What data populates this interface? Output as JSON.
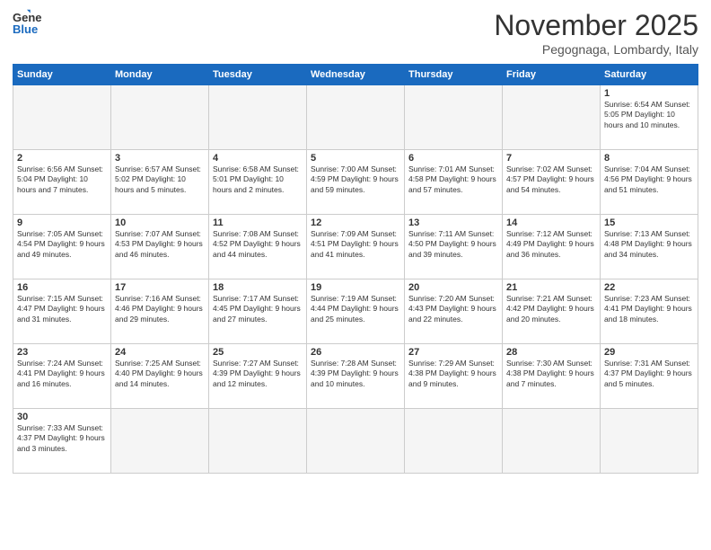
{
  "header": {
    "logo_general": "General",
    "logo_blue": "Blue",
    "month_title": "November 2025",
    "subtitle": "Pegognaga, Lombardy, Italy"
  },
  "days_of_week": [
    "Sunday",
    "Monday",
    "Tuesday",
    "Wednesday",
    "Thursday",
    "Friday",
    "Saturday"
  ],
  "weeks": [
    [
      {
        "day": "",
        "info": ""
      },
      {
        "day": "",
        "info": ""
      },
      {
        "day": "",
        "info": ""
      },
      {
        "day": "",
        "info": ""
      },
      {
        "day": "",
        "info": ""
      },
      {
        "day": "",
        "info": ""
      },
      {
        "day": "1",
        "info": "Sunrise: 6:54 AM\nSunset: 5:05 PM\nDaylight: 10 hours\nand 10 minutes."
      }
    ],
    [
      {
        "day": "2",
        "info": "Sunrise: 6:56 AM\nSunset: 5:04 PM\nDaylight: 10 hours\nand 7 minutes."
      },
      {
        "day": "3",
        "info": "Sunrise: 6:57 AM\nSunset: 5:02 PM\nDaylight: 10 hours\nand 5 minutes."
      },
      {
        "day": "4",
        "info": "Sunrise: 6:58 AM\nSunset: 5:01 PM\nDaylight: 10 hours\nand 2 minutes."
      },
      {
        "day": "5",
        "info": "Sunrise: 7:00 AM\nSunset: 4:59 PM\nDaylight: 9 hours\nand 59 minutes."
      },
      {
        "day": "6",
        "info": "Sunrise: 7:01 AM\nSunset: 4:58 PM\nDaylight: 9 hours\nand 57 minutes."
      },
      {
        "day": "7",
        "info": "Sunrise: 7:02 AM\nSunset: 4:57 PM\nDaylight: 9 hours\nand 54 minutes."
      },
      {
        "day": "8",
        "info": "Sunrise: 7:04 AM\nSunset: 4:56 PM\nDaylight: 9 hours\nand 51 minutes."
      }
    ],
    [
      {
        "day": "9",
        "info": "Sunrise: 7:05 AM\nSunset: 4:54 PM\nDaylight: 9 hours\nand 49 minutes."
      },
      {
        "day": "10",
        "info": "Sunrise: 7:07 AM\nSunset: 4:53 PM\nDaylight: 9 hours\nand 46 minutes."
      },
      {
        "day": "11",
        "info": "Sunrise: 7:08 AM\nSunset: 4:52 PM\nDaylight: 9 hours\nand 44 minutes."
      },
      {
        "day": "12",
        "info": "Sunrise: 7:09 AM\nSunset: 4:51 PM\nDaylight: 9 hours\nand 41 minutes."
      },
      {
        "day": "13",
        "info": "Sunrise: 7:11 AM\nSunset: 4:50 PM\nDaylight: 9 hours\nand 39 minutes."
      },
      {
        "day": "14",
        "info": "Sunrise: 7:12 AM\nSunset: 4:49 PM\nDaylight: 9 hours\nand 36 minutes."
      },
      {
        "day": "15",
        "info": "Sunrise: 7:13 AM\nSunset: 4:48 PM\nDaylight: 9 hours\nand 34 minutes."
      }
    ],
    [
      {
        "day": "16",
        "info": "Sunrise: 7:15 AM\nSunset: 4:47 PM\nDaylight: 9 hours\nand 31 minutes."
      },
      {
        "day": "17",
        "info": "Sunrise: 7:16 AM\nSunset: 4:46 PM\nDaylight: 9 hours\nand 29 minutes."
      },
      {
        "day": "18",
        "info": "Sunrise: 7:17 AM\nSunset: 4:45 PM\nDaylight: 9 hours\nand 27 minutes."
      },
      {
        "day": "19",
        "info": "Sunrise: 7:19 AM\nSunset: 4:44 PM\nDaylight: 9 hours\nand 25 minutes."
      },
      {
        "day": "20",
        "info": "Sunrise: 7:20 AM\nSunset: 4:43 PM\nDaylight: 9 hours\nand 22 minutes."
      },
      {
        "day": "21",
        "info": "Sunrise: 7:21 AM\nSunset: 4:42 PM\nDaylight: 9 hours\nand 20 minutes."
      },
      {
        "day": "22",
        "info": "Sunrise: 7:23 AM\nSunset: 4:41 PM\nDaylight: 9 hours\nand 18 minutes."
      }
    ],
    [
      {
        "day": "23",
        "info": "Sunrise: 7:24 AM\nSunset: 4:41 PM\nDaylight: 9 hours\nand 16 minutes."
      },
      {
        "day": "24",
        "info": "Sunrise: 7:25 AM\nSunset: 4:40 PM\nDaylight: 9 hours\nand 14 minutes."
      },
      {
        "day": "25",
        "info": "Sunrise: 7:27 AM\nSunset: 4:39 PM\nDaylight: 9 hours\nand 12 minutes."
      },
      {
        "day": "26",
        "info": "Sunrise: 7:28 AM\nSunset: 4:39 PM\nDaylight: 9 hours\nand 10 minutes."
      },
      {
        "day": "27",
        "info": "Sunrise: 7:29 AM\nSunset: 4:38 PM\nDaylight: 9 hours\nand 9 minutes."
      },
      {
        "day": "28",
        "info": "Sunrise: 7:30 AM\nSunset: 4:38 PM\nDaylight: 9 hours\nand 7 minutes."
      },
      {
        "day": "29",
        "info": "Sunrise: 7:31 AM\nSunset: 4:37 PM\nDaylight: 9 hours\nand 5 minutes."
      }
    ],
    [
      {
        "day": "30",
        "info": "Sunrise: 7:33 AM\nSunset: 4:37 PM\nDaylight: 9 hours\nand 3 minutes."
      },
      {
        "day": "",
        "info": ""
      },
      {
        "day": "",
        "info": ""
      },
      {
        "day": "",
        "info": ""
      },
      {
        "day": "",
        "info": ""
      },
      {
        "day": "",
        "info": ""
      },
      {
        "day": "",
        "info": ""
      }
    ]
  ]
}
